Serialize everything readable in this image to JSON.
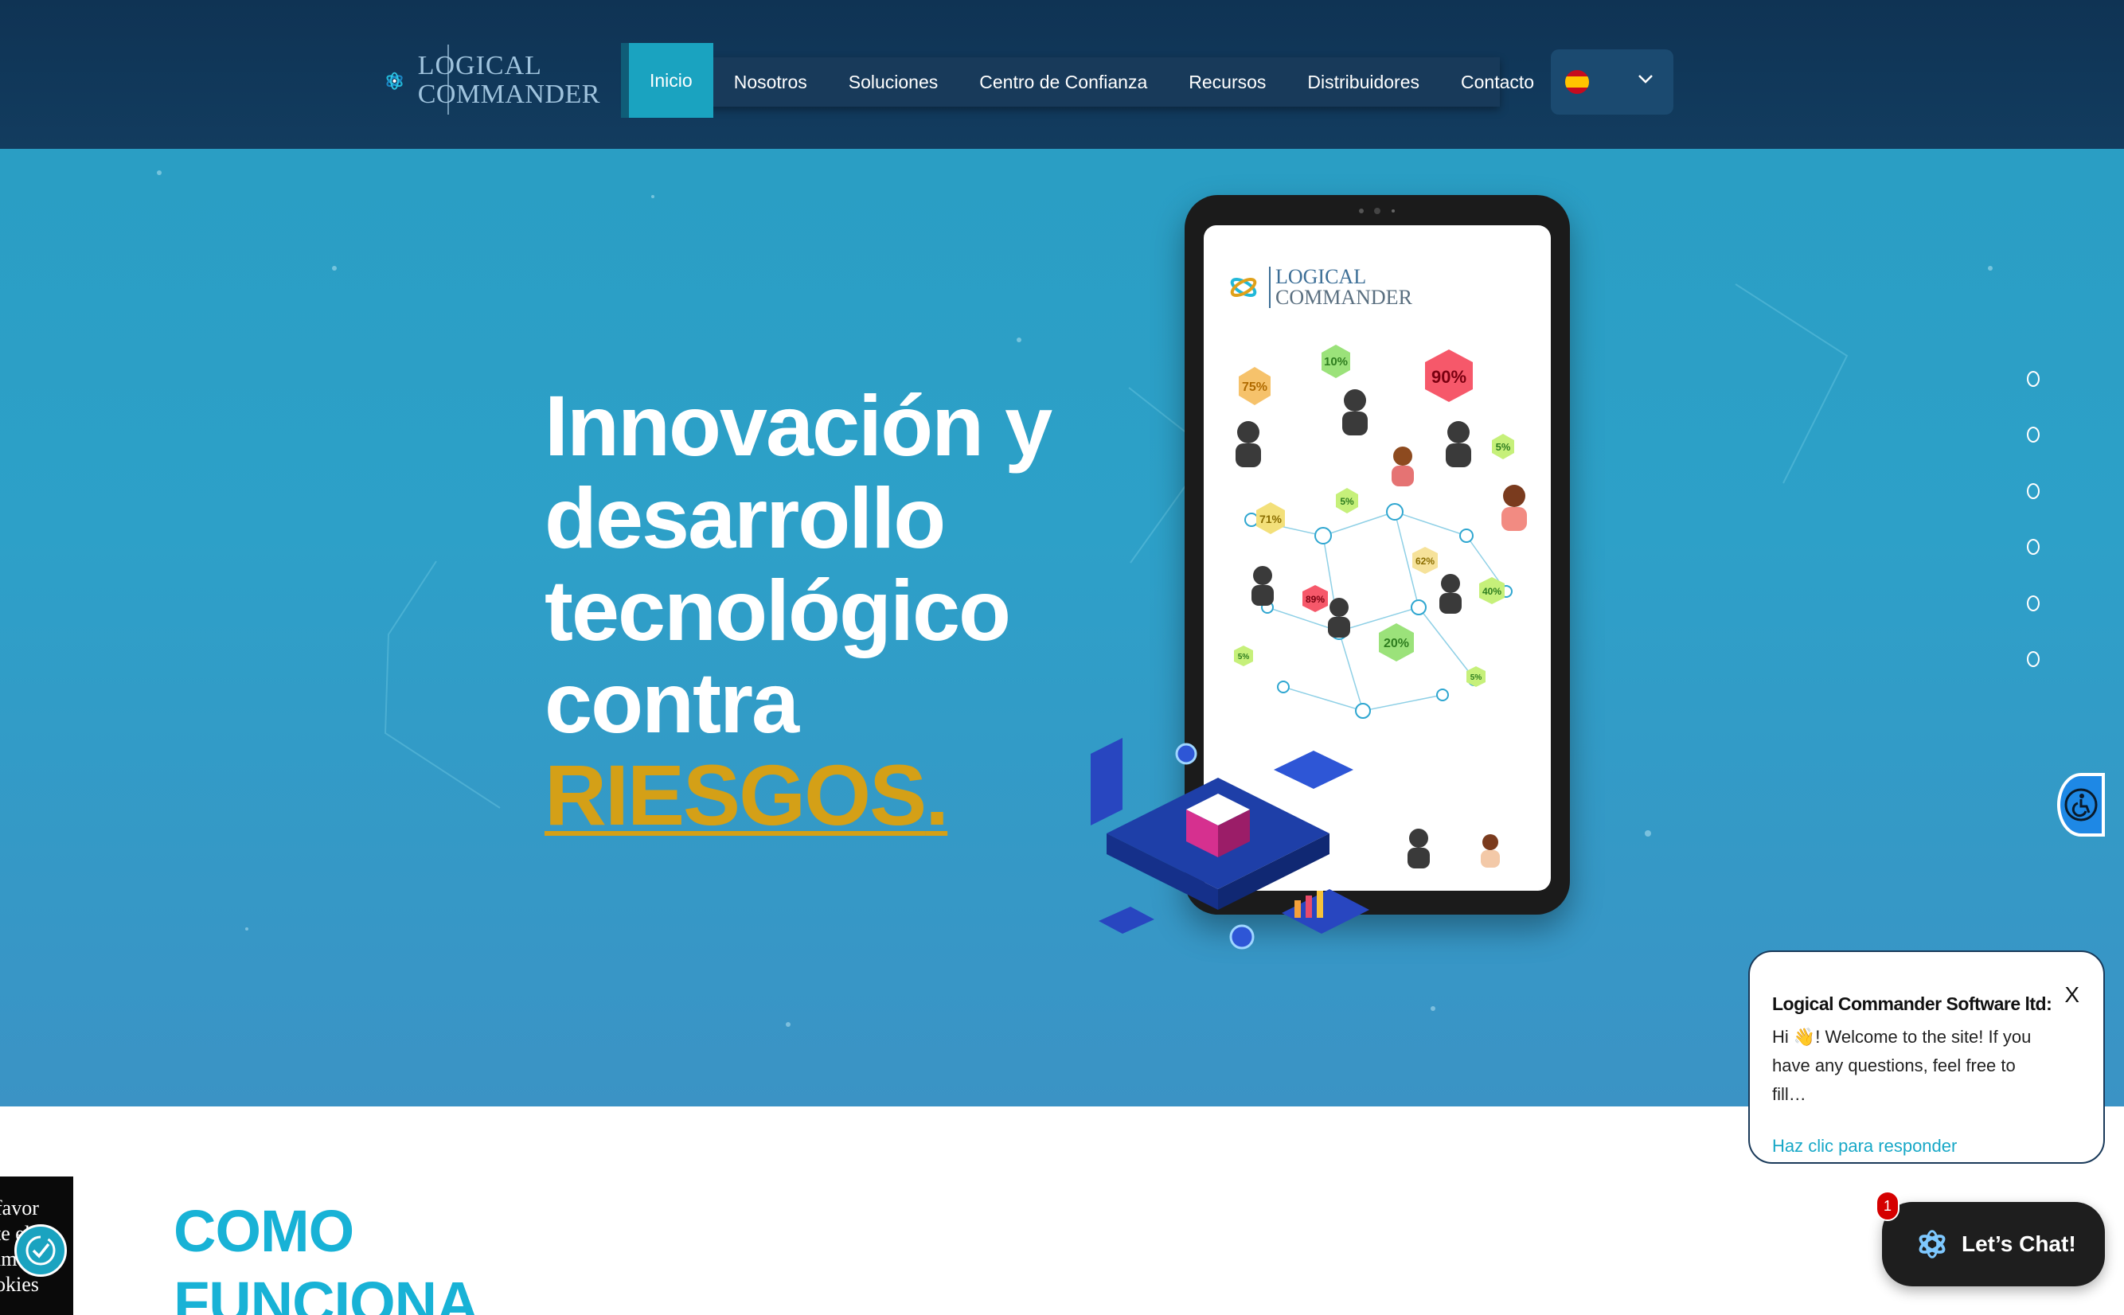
{
  "brand": {
    "line1": "LOGICAL",
    "line2": "COMMANDER"
  },
  "nav": {
    "items": [
      {
        "label": "Inicio",
        "active": true
      },
      {
        "label": "Nosotros"
      },
      {
        "label": "Soluciones"
      },
      {
        "label": "Centro de Confianza"
      },
      {
        "label": "Recursos"
      },
      {
        "label": "Distribuidores"
      },
      {
        "label": "Contacto"
      }
    ]
  },
  "language": {
    "flag_icon": "spain-flag-icon",
    "chevron_icon": "chevron-down-icon"
  },
  "hero": {
    "title_lines": [
      "Innovación y",
      "desarrollo",
      "tecnológico",
      "contra"
    ],
    "highlight": "RIESGOS",
    "highlight_suffix": ".",
    "highlight_color": "#d4a017"
  },
  "tablet": {
    "logo_line1": "LOGICAL",
    "logo_line2": "COMMANDER",
    "percentages": [
      "75%",
      "10%",
      "90%",
      "5%",
      "71%",
      "5%",
      "62%",
      "89%",
      "40%",
      "5%",
      "20%",
      "5%"
    ]
  },
  "slider": {
    "dot_count": 6
  },
  "section": {
    "heading_line1": "COMO",
    "heading_line2": "FUNCIONA"
  },
  "cookie": {
    "lines": [
      "favor",
      "te el",
      "im",
      "okies"
    ]
  },
  "chat_popup": {
    "sender": "Logical Commander Software ltd:",
    "message": "Hi 👋! Welcome to the site! If you have any questions, feel free to fill…",
    "reply_link": "Haz clic para responder",
    "close_label": "X"
  },
  "chat_button": {
    "label": "Let’s Chat!",
    "badge": "1"
  },
  "colors": {
    "header_bg": "#123c5f",
    "hero_bg": "#2da0c8",
    "accent": "#1aa3c0",
    "heading_cyan": "#18b2d6"
  }
}
